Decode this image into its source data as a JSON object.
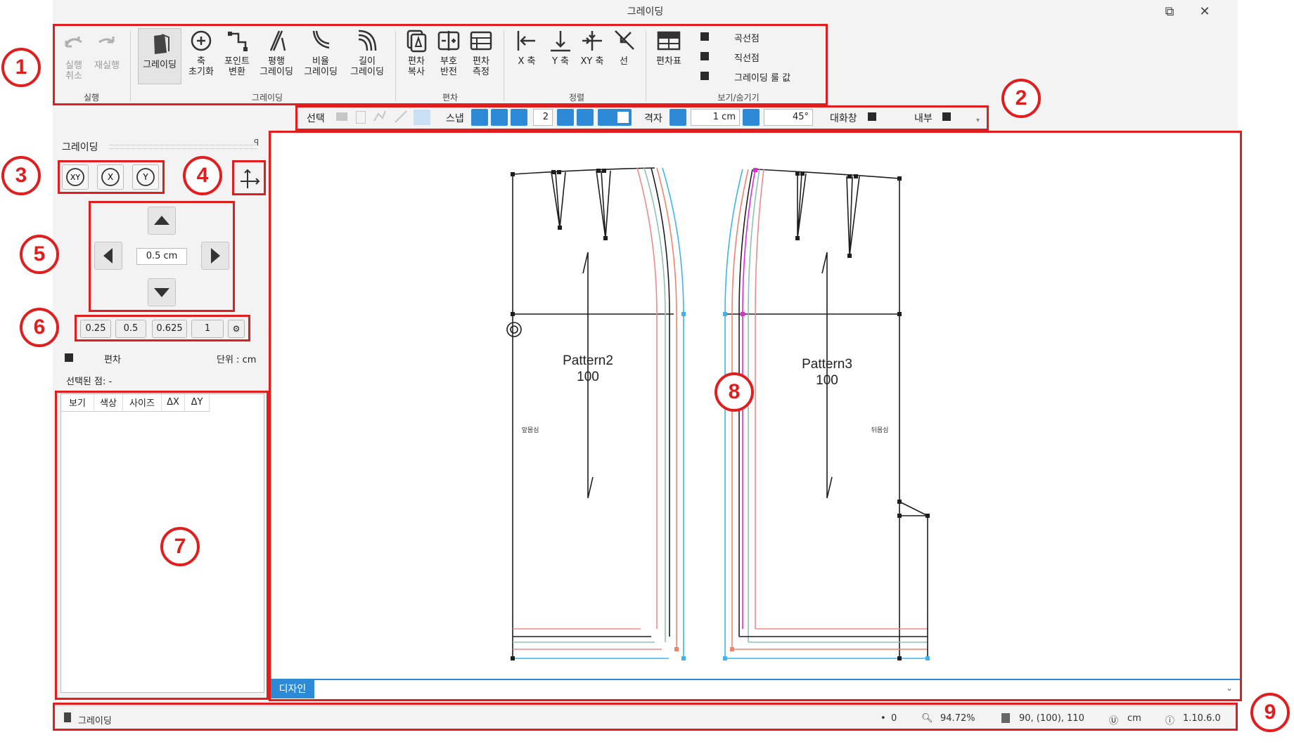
{
  "window": {
    "title": "그레이딩",
    "restore_glyph": "⧉",
    "close_glyph": "✕"
  },
  "callouts": [
    "1",
    "2",
    "3",
    "4",
    "5",
    "6",
    "7",
    "8",
    "9"
  ],
  "ribbon": {
    "undo": {
      "l1": "실행",
      "l2": "취소"
    },
    "redo": {
      "l1": "재실행"
    },
    "grading": {
      "l1": "그레이딩"
    },
    "axis_reset": {
      "l1": "축",
      "l2": "초기화"
    },
    "point_convert": {
      "l1": "포인트",
      "l2": "변환"
    },
    "parallel": {
      "l1": "평행",
      "l2": "그레이딩"
    },
    "ratio": {
      "l1": "비율",
      "l2": "그레이딩"
    },
    "length": {
      "l1": "길이",
      "l2": "그레이딩"
    },
    "dev_copy": {
      "l1": "편차",
      "l2": "복사"
    },
    "sign_flip": {
      "l1": "부호",
      "l2": "반전"
    },
    "dev_measure": {
      "l1": "편차",
      "l2": "측정"
    },
    "align_x": {
      "l1": "X 축"
    },
    "align_y": {
      "l1": "Y 축"
    },
    "align_xy": {
      "l1": "XY 축"
    },
    "align_line": {
      "l1": "선"
    },
    "dev_table": {
      "l1": "편차표"
    },
    "show_curve": "곡선점",
    "show_straight": "직선점",
    "show_grading_value": "그레이딩 룰 값",
    "groups": {
      "exec": "실행",
      "grading": "그레이딩",
      "deviation": "편차",
      "align": "정렬",
      "showhide": "보기/숨기기"
    }
  },
  "toolbar": {
    "select_label": "선택",
    "snap_label": "스냅",
    "snap_value": "2",
    "grid_label": "격자",
    "grid_value": "1 cm",
    "angle_value": "45°",
    "dialog_label": "대화창",
    "inner_label": "내부"
  },
  "panel": {
    "title": "그레이딩",
    "pin": "ㅁ",
    "reset_xy": "XY",
    "reset_x": "X",
    "reset_y": "Y",
    "step_value": "0.5 cm",
    "presets": [
      "0.25",
      "0.5",
      "0.625",
      "1"
    ],
    "deviation_label": "편차",
    "unit_label": "단위 : cm",
    "selected_point": "선택된 점: -",
    "columns": [
      "보기",
      "색상",
      "사이즈",
      "ΔX",
      "ΔY"
    ]
  },
  "canvas": {
    "pattern2_name": "Pattern2",
    "pattern2_size": "100",
    "pattern2_piece": "앞몸심",
    "pattern3_name": "Pattern3",
    "pattern3_size": "100",
    "pattern3_piece": "뒤몸심",
    "colors": {
      "black": "#1e1e1e",
      "red": "#ee8a8a",
      "teal": "#8fc1b8",
      "orange": "#f2836b",
      "blue": "#3fb4ec",
      "magenta": "#e02ad6"
    }
  },
  "tabs": {
    "design": "디자인"
  },
  "status": {
    "mode": "그레이딩",
    "points": "0",
    "zoom": "94.72%",
    "sizes": "90, (100), 110",
    "unit": "cm",
    "version": "1.10.6.0"
  }
}
